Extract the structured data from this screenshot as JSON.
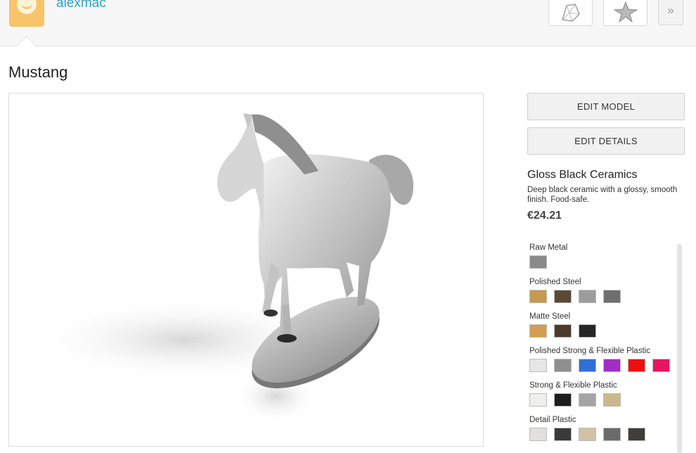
{
  "header": {
    "username": "alexmac",
    "more_label": "»"
  },
  "product": {
    "title": "Mustang"
  },
  "actions": {
    "edit_model": "EDIT MODEL",
    "edit_details": "EDIT DETAILS"
  },
  "selected_material": {
    "name": "Gloss Black Ceramics",
    "description": "Deep black ceramic with a glossy, smooth finish. Food-safe.",
    "price": "€24.21"
  },
  "material_groups": [
    {
      "label": "Raw Metal",
      "swatches": [
        "#8a8a8a"
      ]
    },
    {
      "label": "Polished Steel",
      "swatches": [
        "#c79a4d",
        "#5a4a35",
        "#9c9c9c",
        "#6e6e6e"
      ]
    },
    {
      "label": "Matte Steel",
      "swatches": [
        "#d29d55",
        "#4d3a2a",
        "#262626"
      ]
    },
    {
      "label": "Polished Strong & Flexible Plastic",
      "swatches": [
        "#e6e6e6",
        "#8f8f8f",
        "#2f6fd6",
        "#a12dc4",
        "#ee0e10",
        "#e4165e"
      ]
    },
    {
      "label": "Strong & Flexible Plastic",
      "swatches": [
        "#efefea",
        "#1d1d1d",
        "#a4a4a4",
        "#cbb789"
      ]
    },
    {
      "label": "Detail Plastic",
      "swatches": [
        "#e2e0dc",
        "#3a3a3a",
        "#cfc2a5",
        "#6a6a6a",
        "#3f3f38"
      ]
    }
  ],
  "colors": {
    "accent": "#2aa5cc",
    "avatar_bg": "#f7c46a"
  }
}
